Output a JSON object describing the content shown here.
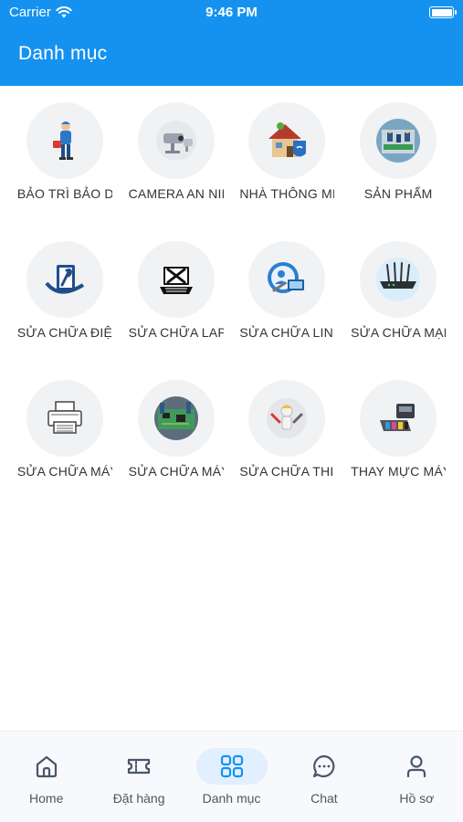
{
  "status_bar": {
    "carrier": "Carrier",
    "time": "9:46 PM"
  },
  "header": {
    "title": "Danh mục"
  },
  "categories": [
    {
      "label": "BẢO TRÌ BẢO DƯỠNG",
      "icon": "maintenance-worker-icon"
    },
    {
      "label": "CAMERA AN NINH",
      "icon": "security-camera-icon"
    },
    {
      "label": "NHÀ THÔNG MINH",
      "icon": "smart-home-icon"
    },
    {
      "label": "SẢN PHẨM",
      "icon": "products-icon"
    },
    {
      "label": "SỬA CHỮA ĐIỆN",
      "icon": "electric-repair-icon"
    },
    {
      "label": "SỬA CHỮA LAPTOP",
      "icon": "laptop-repair-icon"
    },
    {
      "label": "SỬA CHỮA LINH KIỆN",
      "icon": "component-repair-icon"
    },
    {
      "label": "SỬA CHỮA MẠNG",
      "icon": "router-icon"
    },
    {
      "label": "SỬA CHỮA MÁY IN",
      "icon": "printer-icon"
    },
    {
      "label": "SỬA CHỮA MÁY TÍNH",
      "icon": "circuit-board-icon"
    },
    {
      "label": "SỬA CHỮA THIẾT BỊ",
      "icon": "technician-icon"
    },
    {
      "label": "THAY MỰC MÁY IN",
      "icon": "ink-cartridge-icon"
    }
  ],
  "tabs": [
    {
      "label": "Home",
      "icon": "home-icon",
      "active": false
    },
    {
      "label": "Đặt hàng",
      "icon": "ticket-icon",
      "active": false
    },
    {
      "label": "Danh mục",
      "icon": "grid-icon",
      "active": true
    },
    {
      "label": "Chat",
      "icon": "chat-bubble-icon",
      "active": false
    },
    {
      "label": "Hồ sơ",
      "icon": "user-profile-icon",
      "active": false
    }
  ],
  "colors": {
    "primary": "#1592ef",
    "tab_active_bg": "#e2efff",
    "tab_icon": "#4a5568",
    "tab_icon_active": "#1592ef"
  }
}
